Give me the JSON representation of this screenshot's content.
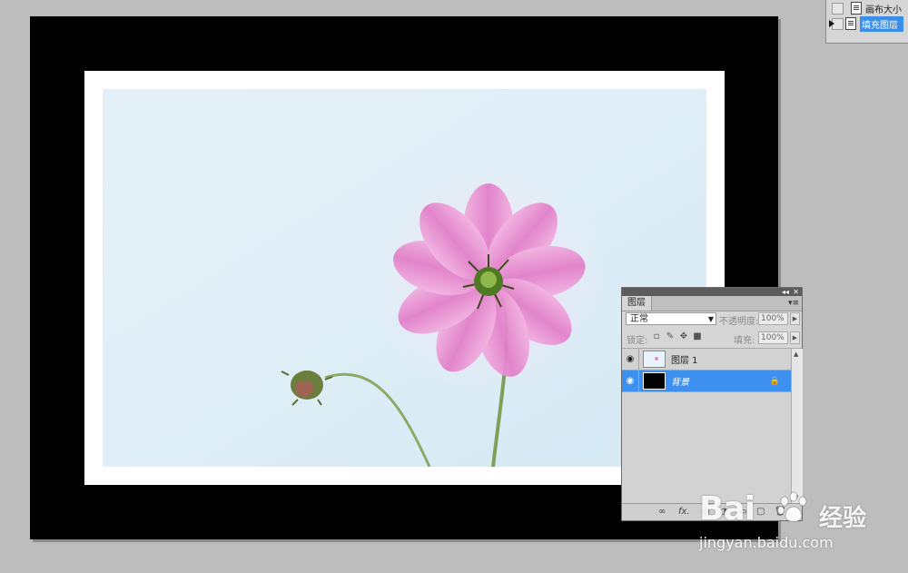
{
  "history": {
    "items": [
      {
        "label": "画布大小",
        "selected": false
      },
      {
        "label": "填充图层",
        "selected": true
      }
    ]
  },
  "layers_panel": {
    "tab": "图层",
    "blend_mode": "正常",
    "opacity_label": "不透明度:",
    "opacity_value": "100%",
    "lock_label": "锁定:",
    "fill_label": "填充:",
    "fill_value": "100%",
    "layers": [
      {
        "name": "图层 1",
        "visible": true,
        "selected": false,
        "locked": false
      },
      {
        "name": "背景",
        "visible": true,
        "selected": true,
        "locked": true
      }
    ]
  },
  "colors": {
    "canvas_border": "#000000",
    "canvas_mat": "#ffffff",
    "selection": "#3d8ff0",
    "panel_bg": "#d6d6d6"
  },
  "watermark": {
    "brand_left": "Bai",
    "brand_cn": "经验",
    "url": "jingyan.baidu.com"
  }
}
